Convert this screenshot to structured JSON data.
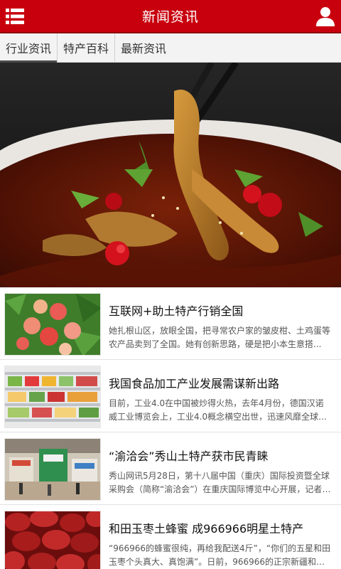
{
  "header": {
    "title": "新闻资讯",
    "menu_icon": "list-menu-icon",
    "user_icon": "user-icon"
  },
  "tabs": [
    {
      "label": "行业资讯",
      "active": true
    },
    {
      "label": "特产百科",
      "active": false
    },
    {
      "label": "最新资讯",
      "active": false
    }
  ],
  "banner": {
    "image": "chili-fish-dish-photo"
  },
  "news": [
    {
      "title": "互联网+助土特产行销全国",
      "summary": "她扎根山区，放眼全国，把寻常农户家的皱皮柑、土鸡蛋等农产品卖到了全国。她有创新思路，硬是把小本生意搭...",
      "thumb": "peaches-photo"
    },
    {
      "title": "我国食品加工产业发展需谋新出路",
      "summary": "目前，工业4.0在中国被炒得火热，去年4月份，德国汉诺威工业博览会上，工业4.0概念横空出世，迅速风靡全球，中...",
      "thumb": "supermarket-shelf-photo"
    },
    {
      "title": "“渝洽会”秀山土特产获市民青睐",
      "summary": "秀山网讯5月28日，第十八届中国（重庆）国际投资暨全球采购会（简称“渝洽会”）在重庆国际博览中心开展，记者在秀...",
      "thumb": "expo-hall-photo"
    },
    {
      "title": "和田玉枣土蜂蜜 成966966明星土特产",
      "summary": "“966966的蜂蜜很纯，再给我配送4斤”，“你们的五星和田玉枣个头真大、真饱满”。日前，966966的正宗新疆和田...",
      "thumb": "red-dates-photo"
    }
  ],
  "colors": {
    "header_red": "#c8000e",
    "tab_bg": "#f3f3f3"
  }
}
